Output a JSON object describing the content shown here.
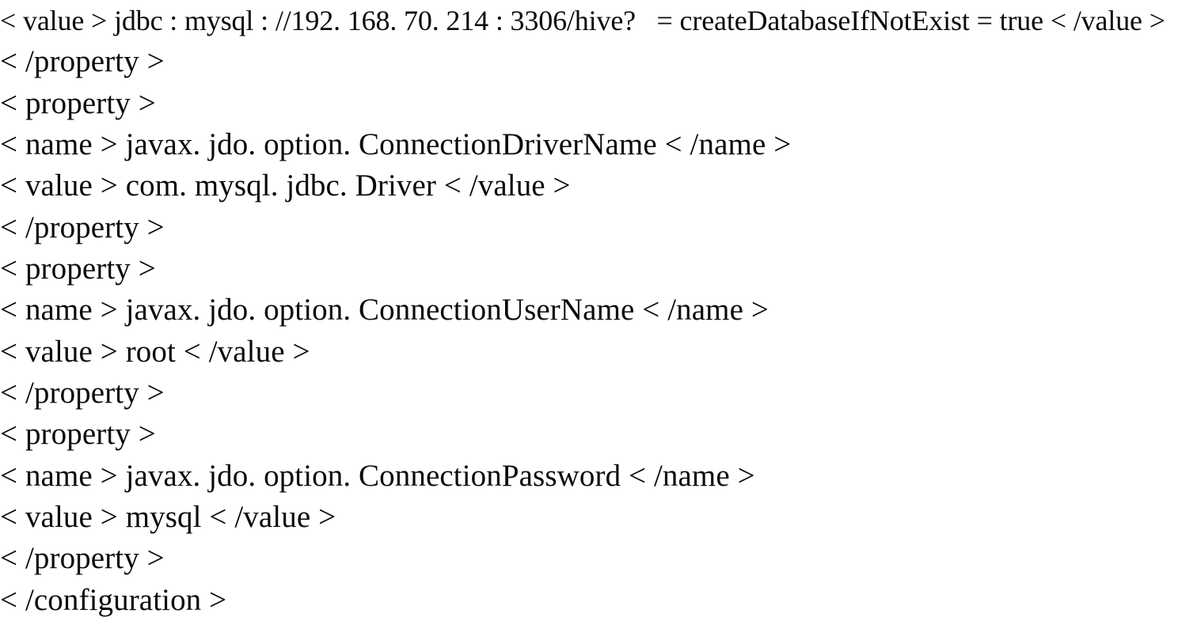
{
  "document": {
    "type": "xml-configuration-fragment",
    "background_color": "#ffffff",
    "text_color": "#0a0a0a",
    "line_count": 15,
    "lines": [
      {
        "index": 1,
        "text": "< value > jdbc : mysql : //192. 168. 70. 214 : 3306/hive?   = createDatabaseIfNotExist = true < /value >"
      },
      {
        "index": 2,
        "text": "< /property >"
      },
      {
        "index": 3,
        "text": "< property >"
      },
      {
        "index": 4,
        "text": "< name > javax. jdo. option. ConnectionDriverName < /name >"
      },
      {
        "index": 5,
        "text": "< value > com. mysql. jdbc. Driver < /value >"
      },
      {
        "index": 6,
        "text": "< /property >"
      },
      {
        "index": 7,
        "text": "< property >"
      },
      {
        "index": 8,
        "text": "< name > javax. jdo. option. ConnectionUserName < /name >"
      },
      {
        "index": 9,
        "text": "< value > root < /value >"
      },
      {
        "index": 10,
        "text": "< /property >"
      },
      {
        "index": 11,
        "text": "< property >"
      },
      {
        "index": 12,
        "text": "< name > javax. jdo. option. ConnectionPassword < /name >"
      },
      {
        "index": 13,
        "text": "< value > mysql < /value >"
      },
      {
        "index": 14,
        "text": "< /property >"
      },
      {
        "index": 15,
        "text": "< /configuration >"
      }
    ],
    "values": {
      "jdbc_connection_url": "jdbc:mysql://192.168.70.214:3306/hive?createDatabaseIfNotExist=true",
      "jdbc_host": "192.168.70.214",
      "jdbc_port": "3306",
      "jdbc_database": "hive",
      "jdbc_option": "createDatabaseIfNotExist = true",
      "connection_driver_name": "com. mysql. jdbc. Driver",
      "connection_user_name": "root",
      "connection_password": "mysql"
    },
    "property_names": [
      "javax. jdo. option. ConnectionDriverName",
      "javax. jdo. option. ConnectionUserName",
      "javax. jdo. option. ConnectionPassword"
    ]
  }
}
